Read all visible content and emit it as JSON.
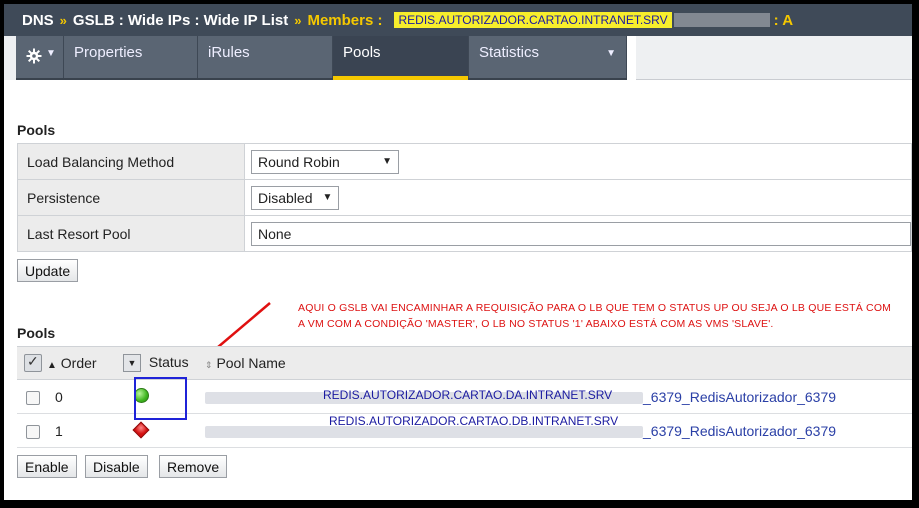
{
  "breadcrumb": {
    "items": [
      "DNS",
      "GSLB : Wide IPs : Wide IP List"
    ],
    "separator": "»",
    "members_label": "Members :",
    "member_name": "REDIS.AUTORIZADOR.CARTAO.INTRANET.SRV",
    "member_suffix": ": A"
  },
  "tabs": {
    "gear_icon": "gear-icon",
    "items": [
      "Properties",
      "iRules",
      "Pools",
      "Statistics"
    ],
    "active": "Pools"
  },
  "pool_settings": {
    "title": "Pools",
    "rows": [
      {
        "label": "Load Balancing Method",
        "value": "Round Robin"
      },
      {
        "label": "Persistence",
        "value": "Disabled"
      },
      {
        "label": "Last Resort Pool",
        "value": "None"
      }
    ],
    "update_label": "Update"
  },
  "annotation": {
    "text": "AQUI O GSLB VAI ENCAMINHAR A REQUISIÇÃO PARA O LB QUE TEM O STATUS UP OU SEJA O LB QUE ESTÁ COM A VM COM A CONDIÇÃO 'MASTER', O LB NO STATUS '1' ABAIXO ESTÁ COM AS VMS 'SLAVE'.",
    "color": "#dd1111"
  },
  "pools_table": {
    "title": "Pools",
    "columns": [
      "Order",
      "Status",
      "Pool Name"
    ],
    "rows": [
      {
        "order": "0",
        "status": "available",
        "status_icon": "green-circle-icon",
        "highlight": "REDIS.AUTORIZADOR.CARTAO.DA.INTRANET.SRV",
        "pool_suffix": "_6379_RedisAutorizador_6379"
      },
      {
        "order": "1",
        "status": "offline",
        "status_icon": "red-diamond-icon",
        "highlight": "REDIS.AUTORIZADOR.CARTAO.DB.INTRANET.SRV",
        "pool_suffix": "_6379_RedisAutorizador_6379"
      }
    ],
    "buttons": [
      "Enable",
      "Disable",
      "Remove"
    ]
  },
  "colors": {
    "header_bg": "#3f4a58",
    "accent": "#f5c800",
    "link": "#2a3fa6",
    "callout": "#1f23d8"
  }
}
